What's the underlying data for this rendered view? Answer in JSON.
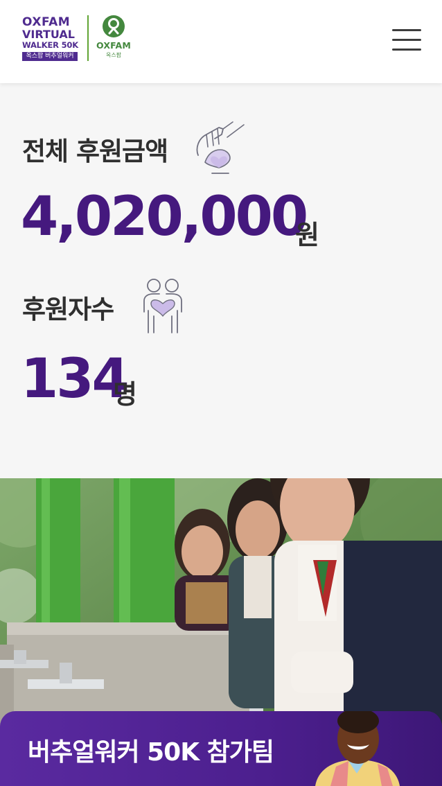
{
  "header": {
    "logo_line1": "OXFAM",
    "logo_line2": "VIRTUAL",
    "logo_line3": "WALKER 50K",
    "logo_line4": "옥스팜 버추얼워커",
    "oxfam_brand": "OXFAM",
    "oxfam_sub": "옥스팜",
    "menu_icon": "hamburger-menu-icon"
  },
  "stats": {
    "total_label": "전체 후원금액",
    "total_icon": "hand-heart-donate-icon",
    "total_value": "4,020,000",
    "total_unit": "원",
    "count_label": "후원자수",
    "count_icon": "two-people-heart-icon",
    "count_value": "134",
    "count_unit": "명"
  },
  "banner": {
    "label": "버추얼워커 50K 참가팀"
  },
  "colors": {
    "brand_purple": "#45197e",
    "banner_purple": "#5a2aa0",
    "oxfam_green": "#44883e",
    "stats_bg": "#f6f6f6"
  }
}
